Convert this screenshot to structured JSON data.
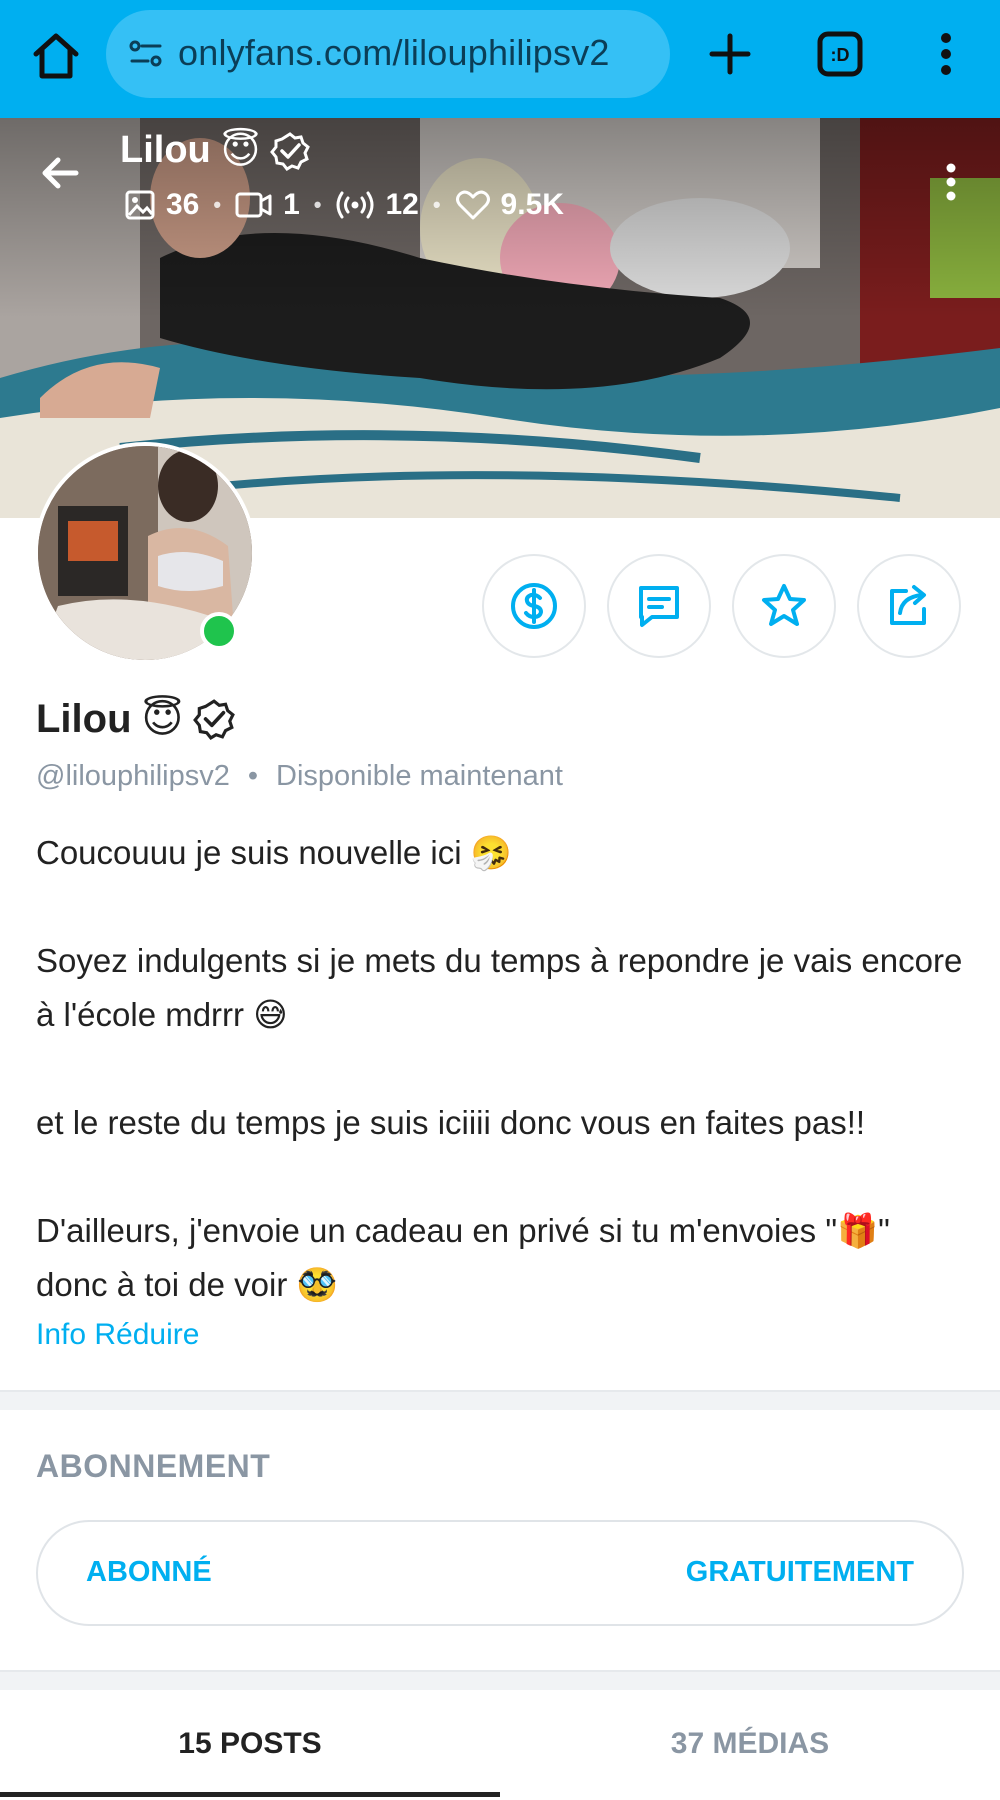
{
  "browser": {
    "url": "onlyfans.com/lilouphilipsv2",
    "tabs_count_label": ":D"
  },
  "cover": {
    "name": "Lilou",
    "name_emoji": "😇",
    "stats": {
      "photos": "36",
      "videos": "1",
      "streams": "12",
      "likes": "9.5K"
    }
  },
  "profile": {
    "name": "Lilou",
    "name_emoji": "😇",
    "handle": "@lilouphilipsv2",
    "separator": "•",
    "status": "Disponible maintenant",
    "bio": [
      "Coucouuu je suis nouvelle ici 🤧",
      "Soyez indulgents si je mets du temps à repondre je vais encore à l'école mdrrr 😅",
      "et le reste du temps je suis iciiii donc vous en faites pas!!",
      "D'ailleurs, j'envoie un cadeau en privé si tu m'envoies \"🎁\" donc à toi de voir 🥸"
    ],
    "info_link": "Info Réduire"
  },
  "subscription": {
    "section_title": "ABONNEMENT",
    "left_label": "ABONNÉ",
    "right_label": "GRATUITEMENT"
  },
  "tabs": [
    {
      "label": "15 POSTS",
      "active": true
    },
    {
      "label": "37 MÉDIAS",
      "active": false
    }
  ],
  "colors": {
    "brand": "#00aff0",
    "muted": "#8a96a3",
    "online": "#1fc44d"
  }
}
